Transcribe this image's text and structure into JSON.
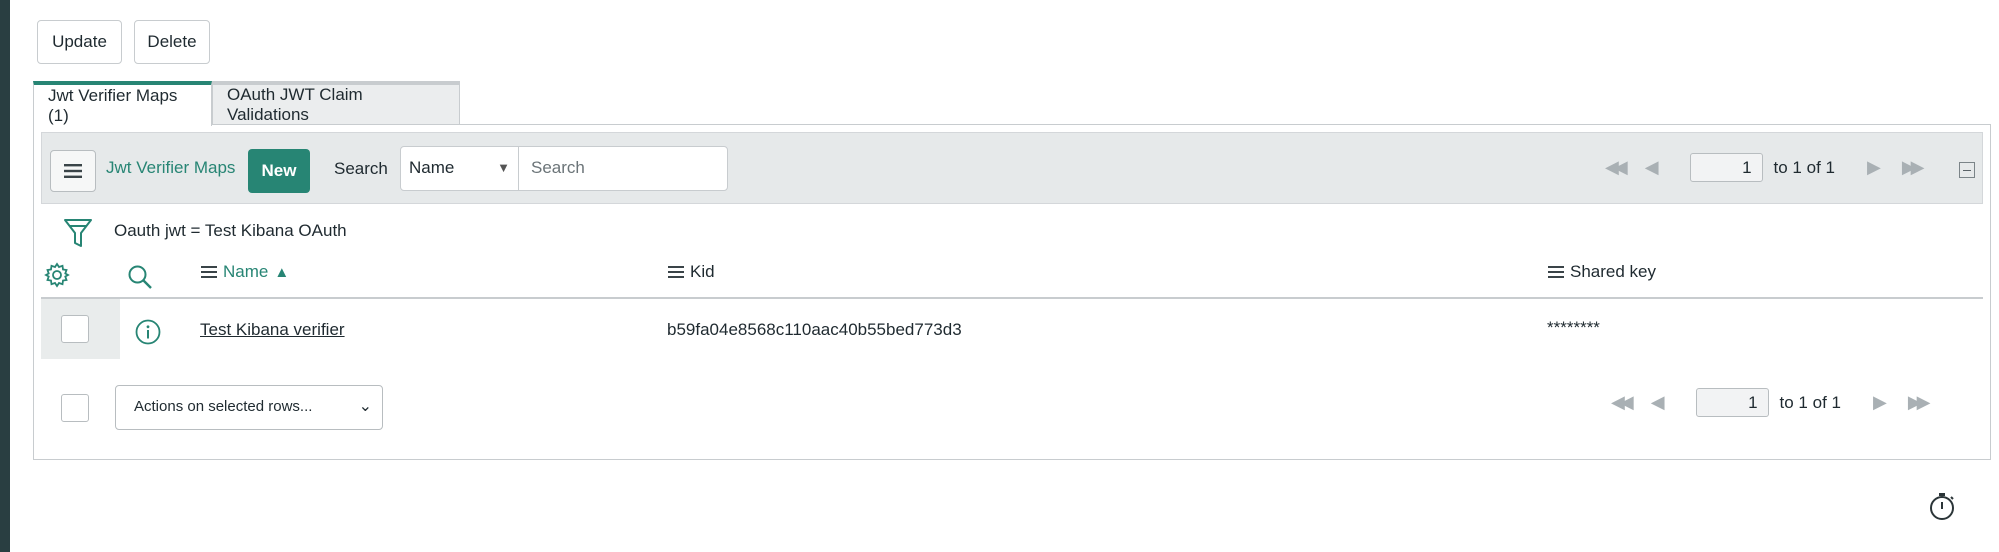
{
  "toolbar": {
    "update_label": "Update",
    "delete_label": "Delete"
  },
  "tabs": [
    {
      "label": "Jwt Verifier Maps (1)",
      "active": true
    },
    {
      "label": "OAuth JWT Claim Validations",
      "active": false
    }
  ],
  "list": {
    "title": "Jwt Verifier Maps",
    "new_label": "New",
    "search_label": "Search",
    "search_field": "Name",
    "search_placeholder": "Search",
    "filter": "Oauth jwt = Test Kibana OAuth",
    "columns": [
      {
        "label": "Name",
        "sorted": "asc"
      },
      {
        "label": "Kid"
      },
      {
        "label": "Shared key"
      }
    ],
    "rows": [
      {
        "name": "Test Kibana verifier",
        "kid": "b59fa04e8568c110aac40b55bed773d3",
        "shared_key": "********"
      }
    ],
    "actions_placeholder": "Actions on selected rows..."
  },
  "pagination_top": {
    "page": "1",
    "range_text": "to 1 of 1"
  },
  "pagination_bottom": {
    "page": "1",
    "range_text": "to 1 of 1"
  },
  "colors": {
    "accent": "#278574",
    "leftbar": "#293e41",
    "listbar_bg": "#e6e9ea"
  },
  "icons": [
    "hamburger-icon",
    "filter-icon",
    "gear-icon",
    "search-icon",
    "info-icon",
    "sort-ascending-icon",
    "first-page-icon",
    "previous-page-icon",
    "next-page-icon",
    "last-page-icon",
    "collapse-icon",
    "stopwatch-icon"
  ]
}
